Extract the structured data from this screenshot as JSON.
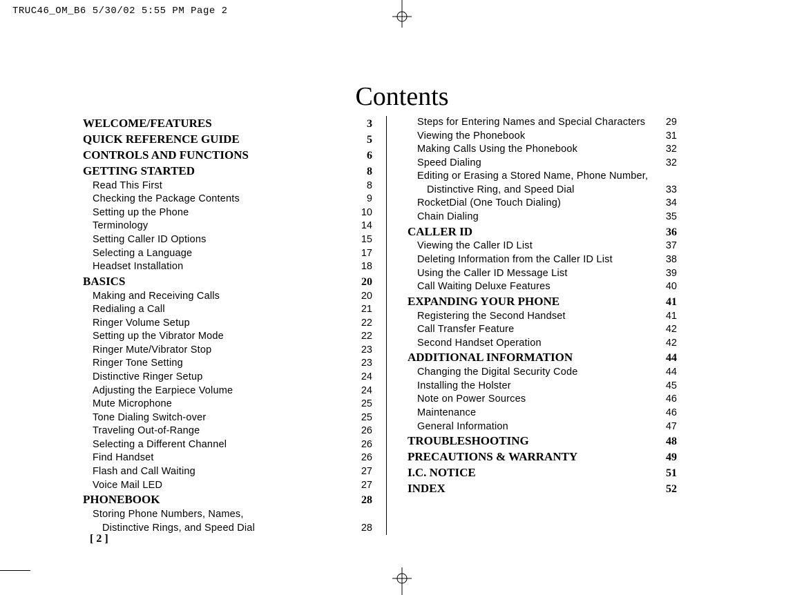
{
  "print_header": "TRUC46_OM_B6  5/30/02  5:55 PM  Page 2",
  "page_title": "Contents",
  "footer_page": "[ 2 ]",
  "left_col": [
    {
      "type": "section",
      "label": "WELCOME/FEATURES",
      "page": "3"
    },
    {
      "type": "section",
      "label": "QUICK REFERENCE GUIDE",
      "page": "5"
    },
    {
      "type": "section",
      "label": "CONTROLS AND FUNCTIONS",
      "page": "6"
    },
    {
      "type": "section",
      "label": "GETTING STARTED",
      "page": "8"
    },
    {
      "type": "sub",
      "label": "Read This First",
      "page": "8"
    },
    {
      "type": "sub",
      "label": "Checking the Package Contents",
      "page": "9"
    },
    {
      "type": "sub",
      "label": "Setting up the Phone",
      "page": "10"
    },
    {
      "type": "sub",
      "label": "Terminology",
      "page": "14"
    },
    {
      "type": "sub",
      "label": "Setting Caller ID Options",
      "page": "15"
    },
    {
      "type": "sub",
      "label": "Selecting a Language",
      "page": "17"
    },
    {
      "type": "sub",
      "label": "Headset Installation",
      "page": "18"
    },
    {
      "type": "section",
      "label": "BASICS",
      "page": "20"
    },
    {
      "type": "sub",
      "label": "Making and Receiving Calls",
      "page": "20"
    },
    {
      "type": "sub",
      "label": "Redialing a Call",
      "page": "21"
    },
    {
      "type": "sub",
      "label": "Ringer Volume Setup",
      "page": "22"
    },
    {
      "type": "sub",
      "label": "Setting up the Vibrator Mode",
      "page": "22"
    },
    {
      "type": "sub",
      "label": "Ringer Mute/Vibrator Stop",
      "page": "23"
    },
    {
      "type": "sub",
      "label": "Ringer Tone Setting",
      "page": "23"
    },
    {
      "type": "sub",
      "label": "Distinctive Ringer Setup",
      "page": "24"
    },
    {
      "type": "sub",
      "label": "Adjusting the Earpiece Volume",
      "page": "24"
    },
    {
      "type": "sub",
      "label": "Mute Microphone",
      "page": "25"
    },
    {
      "type": "sub",
      "label": "Tone Dialing Switch-over",
      "page": "25"
    },
    {
      "type": "sub",
      "label": "Traveling Out-of-Range",
      "page": "26"
    },
    {
      "type": "sub",
      "label": "Selecting a Different Channel",
      "page": "26"
    },
    {
      "type": "sub",
      "label": "Find Handset",
      "page": "26"
    },
    {
      "type": "sub",
      "label": "Flash and Call Waiting",
      "page": "27"
    },
    {
      "type": "sub",
      "label": "Voice Mail LED",
      "page": "27"
    },
    {
      "type": "section",
      "label": "PHONEBOOK",
      "page": "28"
    },
    {
      "type": "sub",
      "label": "Storing Phone Numbers, Names,",
      "page": ""
    },
    {
      "type": "subcont",
      "label": "Distinctive Rings, and Speed Dial",
      "page": "28"
    }
  ],
  "right_col": [
    {
      "type": "sub",
      "label": "Steps for Entering Names and Special Characters",
      "page": "29"
    },
    {
      "type": "sub",
      "label": "Viewing the Phonebook",
      "page": "31"
    },
    {
      "type": "sub",
      "label": "Making Calls Using the Phonebook",
      "page": "32"
    },
    {
      "type": "sub",
      "label": "Speed Dialing",
      "page": "32"
    },
    {
      "type": "sub",
      "label": "Editing or Erasing a Stored Name, Phone Number,",
      "page": ""
    },
    {
      "type": "subcont",
      "label": "Distinctive Ring, and Speed Dial",
      "page": "33"
    },
    {
      "type": "sub",
      "label": "RocketDial (One Touch Dialing)",
      "page": "34"
    },
    {
      "type": "sub",
      "label": "Chain Dialing",
      "page": "35"
    },
    {
      "type": "section",
      "label": "CALLER ID",
      "page": "36"
    },
    {
      "type": "sub",
      "label": "Viewing the Caller ID List",
      "page": "37"
    },
    {
      "type": "sub",
      "label": "Deleting Information from the Caller ID List",
      "page": "38"
    },
    {
      "type": "sub",
      "label": "Using the Caller ID Message List",
      "page": "39"
    },
    {
      "type": "sub",
      "label": "Call Waiting Deluxe Features",
      "page": "40"
    },
    {
      "type": "section",
      "label": "EXPANDING YOUR PHONE",
      "page": "41"
    },
    {
      "type": "sub",
      "label": "Registering the Second Handset",
      "page": "41"
    },
    {
      "type": "sub",
      "label": "Call Transfer Feature",
      "page": "42"
    },
    {
      "type": "sub",
      "label": "Second Handset Operation",
      "page": "42"
    },
    {
      "type": "section",
      "label": "ADDITIONAL INFORMATION",
      "page": "44"
    },
    {
      "type": "sub",
      "label": "Changing the Digital Security Code",
      "page": "44"
    },
    {
      "type": "sub",
      "label": "Installing the Holster",
      "page": "45"
    },
    {
      "type": "sub",
      "label": "Note on Power Sources",
      "page": "46"
    },
    {
      "type": "sub",
      "label": "Maintenance",
      "page": "46"
    },
    {
      "type": "sub",
      "label": "General Information",
      "page": "47"
    },
    {
      "type": "section",
      "label": "TROUBLESHOOTING",
      "page": "48"
    },
    {
      "type": "section",
      "label": "PRECAUTIONS & WARRANTY",
      "page": "49"
    },
    {
      "type": "section",
      "label": "I.C. NOTICE",
      "page": "51"
    },
    {
      "type": "section",
      "label": "INDEX",
      "page": "52"
    }
  ]
}
